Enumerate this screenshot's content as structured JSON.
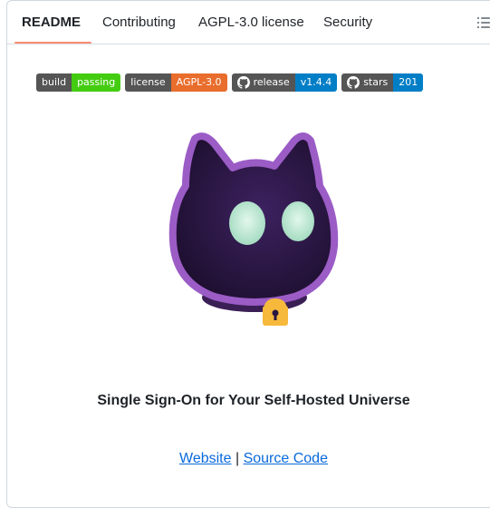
{
  "tabs": [
    {
      "label": "README",
      "active": true
    },
    {
      "label": "Contributing",
      "active": false
    },
    {
      "label": "AGPL-3.0 license",
      "active": false
    },
    {
      "label": "Security",
      "active": false
    }
  ],
  "toc_icon": "list-unordered-icon",
  "badges": [
    {
      "left": "build",
      "right": "passing",
      "color": "#4c1",
      "icon": null
    },
    {
      "left": "license",
      "right": "AGPL-3.0",
      "color": "#e96d2c",
      "icon": null
    },
    {
      "left": "release",
      "right": "v1.4.4",
      "color": "#007ec6",
      "icon": "github-icon"
    },
    {
      "left": "stars",
      "right": "201",
      "color": "#007ec6",
      "icon": "github-icon"
    }
  ],
  "colors": {
    "tab_underline": "#fd8c73",
    "link": "#0969da",
    "mascot_outline": "#9b5cc6",
    "mascot_body": "#2a1640",
    "mascot_eyes": "#b8e8d0",
    "lock": "#f6b93b"
  },
  "tagline": "Single Sign-On for Your Self-Hosted Universe",
  "links": {
    "website": "Website",
    "separator": " | ",
    "source_code": "Source Code"
  }
}
